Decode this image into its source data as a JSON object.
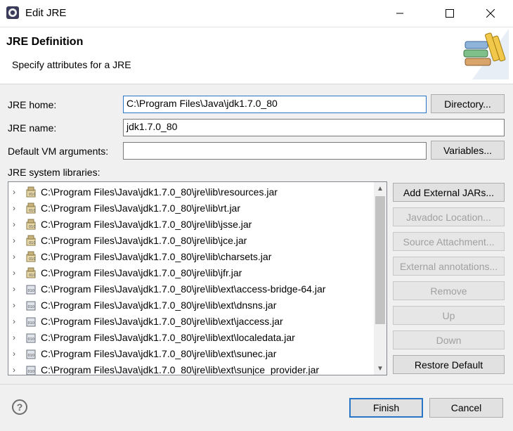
{
  "window": {
    "title": "Edit JRE",
    "minimize_icon": "minimize-icon",
    "maximize_icon": "maximize-icon",
    "close_icon": "close-icon"
  },
  "header": {
    "title": "JRE Definition",
    "description": "Specify attributes for a JRE",
    "logo_icon": "library-books-icon"
  },
  "form": {
    "jre_home_label": "JRE home:",
    "jre_home_value": "C:\\Program Files\\Java\\jdk1.7.0_80",
    "directory_button": "Directory...",
    "jre_name_label": "JRE name:",
    "jre_name_value": "jdk1.7.0_80",
    "vm_args_label": "Default VM arguments:",
    "vm_args_value": "",
    "variables_button": "Variables...",
    "libraries_label": "JRE system libraries:"
  },
  "libraries": [
    "C:\\Program Files\\Java\\jdk1.7.0_80\\jre\\lib\\resources.jar",
    "C:\\Program Files\\Java\\jdk1.7.0_80\\jre\\lib\\rt.jar",
    "C:\\Program Files\\Java\\jdk1.7.0_80\\jre\\lib\\jsse.jar",
    "C:\\Program Files\\Java\\jdk1.7.0_80\\jre\\lib\\jce.jar",
    "C:\\Program Files\\Java\\jdk1.7.0_80\\jre\\lib\\charsets.jar",
    "C:\\Program Files\\Java\\jdk1.7.0_80\\jre\\lib\\jfr.jar",
    "C:\\Program Files\\Java\\jdk1.7.0_80\\jre\\lib\\ext\\access-bridge-64.jar",
    "C:\\Program Files\\Java\\jdk1.7.0_80\\jre\\lib\\ext\\dnsns.jar",
    "C:\\Program Files\\Java\\jdk1.7.0_80\\jre\\lib\\ext\\jaccess.jar",
    "C:\\Program Files\\Java\\jdk1.7.0_80\\jre\\lib\\ext\\localedata.jar",
    "C:\\Program Files\\Java\\jdk1.7.0_80\\jre\\lib\\ext\\sunec.jar",
    "C:\\Program Files\\Java\\jdk1.7.0_80\\jre\\lib\\ext\\sunjce_provider.jar"
  ],
  "side_buttons": {
    "add_external_jars": "Add External JARs...",
    "javadoc_location": "Javadoc Location...",
    "source_attachment": "Source Attachment...",
    "external_annotations": "External annotations...",
    "remove": "Remove",
    "up": "Up",
    "down": "Down",
    "restore_default": "Restore Default"
  },
  "footer": {
    "help_icon": "help-icon",
    "finish": "Finish",
    "cancel": "Cancel"
  }
}
